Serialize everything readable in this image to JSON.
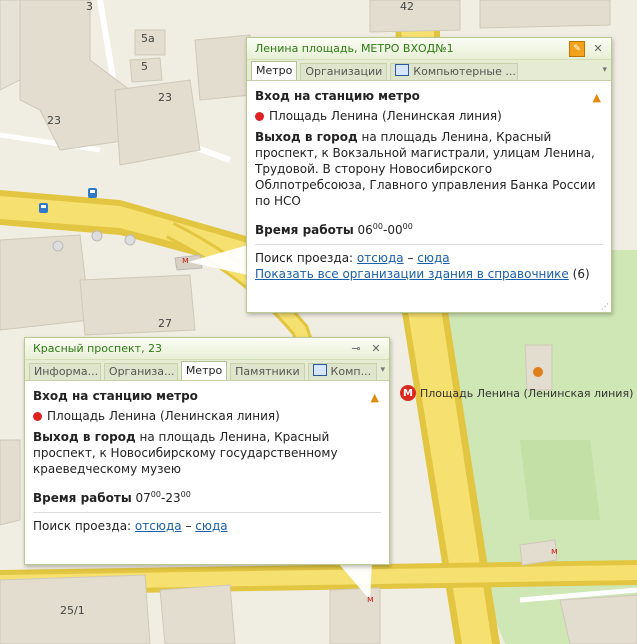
{
  "map": {
    "labels": {
      "h3": "3",
      "h42": "42",
      "h5a": "5а",
      "h5": "5",
      "h23a": "23",
      "h23b": "23",
      "h27": "27",
      "h25_1": "25/1",
      "metro_label": "Площадь Ленина (Ленинская линия)",
      "metro_letter": "М",
      "small_m1": "м",
      "small_m2": "м",
      "small_m3": "м"
    },
    "colors": {
      "road": "#f6e070",
      "road_edge": "#e2c642",
      "park": "#cfe7b5",
      "building": "#e2ddcf",
      "ground": "#f0eee2"
    }
  },
  "popup1": {
    "title": "Ленина площадь, МЕТРО ВХОД№1",
    "tabs": [
      "Метро",
      "Организации",
      "Компьютерные ..."
    ],
    "active_tab": 0,
    "heading": "Вход на станцию метро",
    "station": "Площадь Ленина (Ленинская линия)",
    "exit_label": "Выход в город",
    "exit_text": " на площадь Ленина, Красный проспект, к Вокзальной магистрали, улицам Ленина, Трудовой. В сторону Новосибирского Облпотребсоюза, Главного управления Банка России по НСО",
    "hours_label": "Время работы",
    "hours_from": "06",
    "hours_from_sup": "00",
    "hours_to": "00",
    "hours_to_sup": "00",
    "route_label": "Поиск проезда:",
    "route_from": "отсюда",
    "route_dash": "–",
    "route_to": "сюда",
    "show_all": "Показать все организации здания в справочнике",
    "show_all_count": "(6)"
  },
  "popup2": {
    "title": "Красный проспект, 23",
    "tabs": [
      "Информа...",
      "Организа...",
      "Метро",
      "Памятники",
      "Комп..."
    ],
    "active_tab": 2,
    "heading": "Вход на станцию метро",
    "station": "Площадь Ленина (Ленинская линия)",
    "exit_label": "Выход в город",
    "exit_text": " на площадь Ленина, Красный проспект, к Новосибирскому государственному краеведческому музею",
    "hours_label": "Время работы",
    "hours_from": "07",
    "hours_from_sup": "00",
    "hours_to": "23",
    "hours_to_sup": "00",
    "route_label": "Поиск проезда:",
    "route_from": "отсюда",
    "route_dash": "–",
    "route_to": "сюда"
  }
}
